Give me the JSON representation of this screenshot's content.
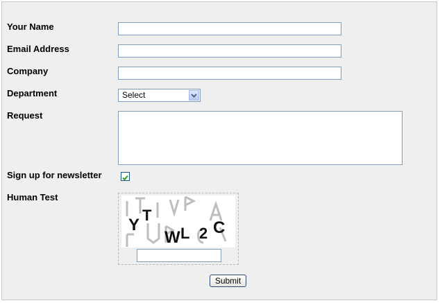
{
  "form": {
    "name_label": "Your Name",
    "email_label": "Email Address",
    "company_label": "Company",
    "department_label": "Department",
    "department_selected": "Select",
    "request_label": "Request",
    "newsletter_label": "Sign up for newsletter",
    "newsletter_checked": true,
    "human_test_label": "Human Test",
    "captcha_text": "YTWL2C",
    "submit_label": "Submit"
  },
  "colors": {
    "panel_bg": "#efefef",
    "input_border": "#7f9db9",
    "checkmark": "#21a121"
  },
  "icons": [
    "dropdown-arrow-icon",
    "checkmark-icon"
  ]
}
